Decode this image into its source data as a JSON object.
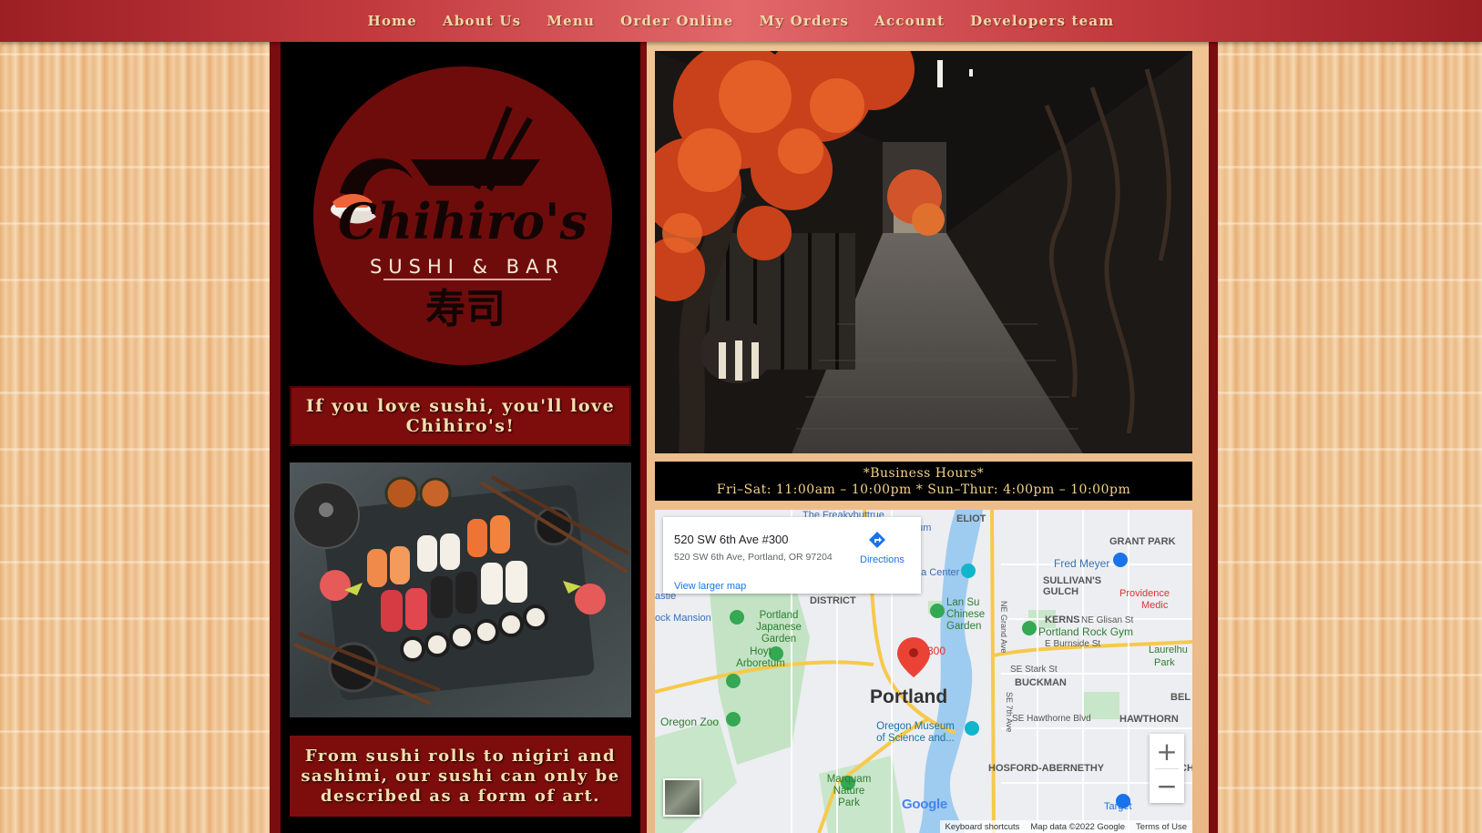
{
  "nav": {
    "items": [
      {
        "label": "Home"
      },
      {
        "label": "About Us"
      },
      {
        "label": "Menu"
      },
      {
        "label": "Order Online"
      },
      {
        "label": "My Orders"
      },
      {
        "label": "Account"
      },
      {
        "label": "Developers team"
      }
    ]
  },
  "logo": {
    "brand": "Chihiro's",
    "tagline": "SUSHI & BAR",
    "kanji": "寿司"
  },
  "slogan": "If you love sushi, you'll love Chihiro's!",
  "art_text": "From sushi rolls to nigiri and sashimi, our sushi can only be described as a form of art.",
  "hours": {
    "title": "*Business Hours*",
    "detail": "Fri–Sat: 11:00am – 10:00pm * Sun–Thur: 4:00pm – 10:00pm"
  },
  "map": {
    "card": {
      "title": "520 SW 6th Ave #300",
      "address": "520 SW 6th Ave, Portland, OR 97204",
      "directions": "Directions",
      "larger_map": "View larger map"
    },
    "marker_label": "300",
    "labels": {
      "portland": "Portland",
      "fred_meyer": "Fred Meyer",
      "grant_park": "GRANT PARK",
      "sullivans": "SULLIVAN'S",
      "gulch": "GULCH",
      "providence": "Providence",
      "medic": "Medic",
      "kerns": "KERNS",
      "ne_glisan": "NE Glisan St",
      "rock_gym": "Portland Rock Gym",
      "burnside": "E Burnside St",
      "laurelhu": "Laurelhu",
      "park": "Park",
      "stark": "SE Stark St",
      "buckman": "BUCKMAN",
      "hawthorne_blvd": "SE Hawthorne Blvd",
      "hawthorn": "HAWTHORN",
      "hosford": "HOSFORD-ABERNETHY",
      "japanese_garden": "Portland Japanese Garden",
      "hoyt": "Hoyt Arboretum",
      "zoo": "Oregon Zoo",
      "omsi": "Oregon Museum of Science and...",
      "marquam": "Marquam Nature Park",
      "lan_su": "Lan Su Chinese Garden",
      "district": "DISTRICT",
      "mansion": "ock Mansion",
      "center": "da Center",
      "eliot": "ELIOT",
      "freakybuttrue": "The Freakybuttrue",
      "eum": "eum",
      "astle": "astle",
      "ne_grand": "NE Grand Ave",
      "se_7th": "SE 7th Ave",
      "bel": "BEL",
      "target": "Target",
      "ch": "CH"
    },
    "footer": {
      "shortcuts": "Keyboard shortcuts",
      "data": "Map data ©2022 Google",
      "terms": "Terms of Use"
    },
    "google": "Google"
  }
}
